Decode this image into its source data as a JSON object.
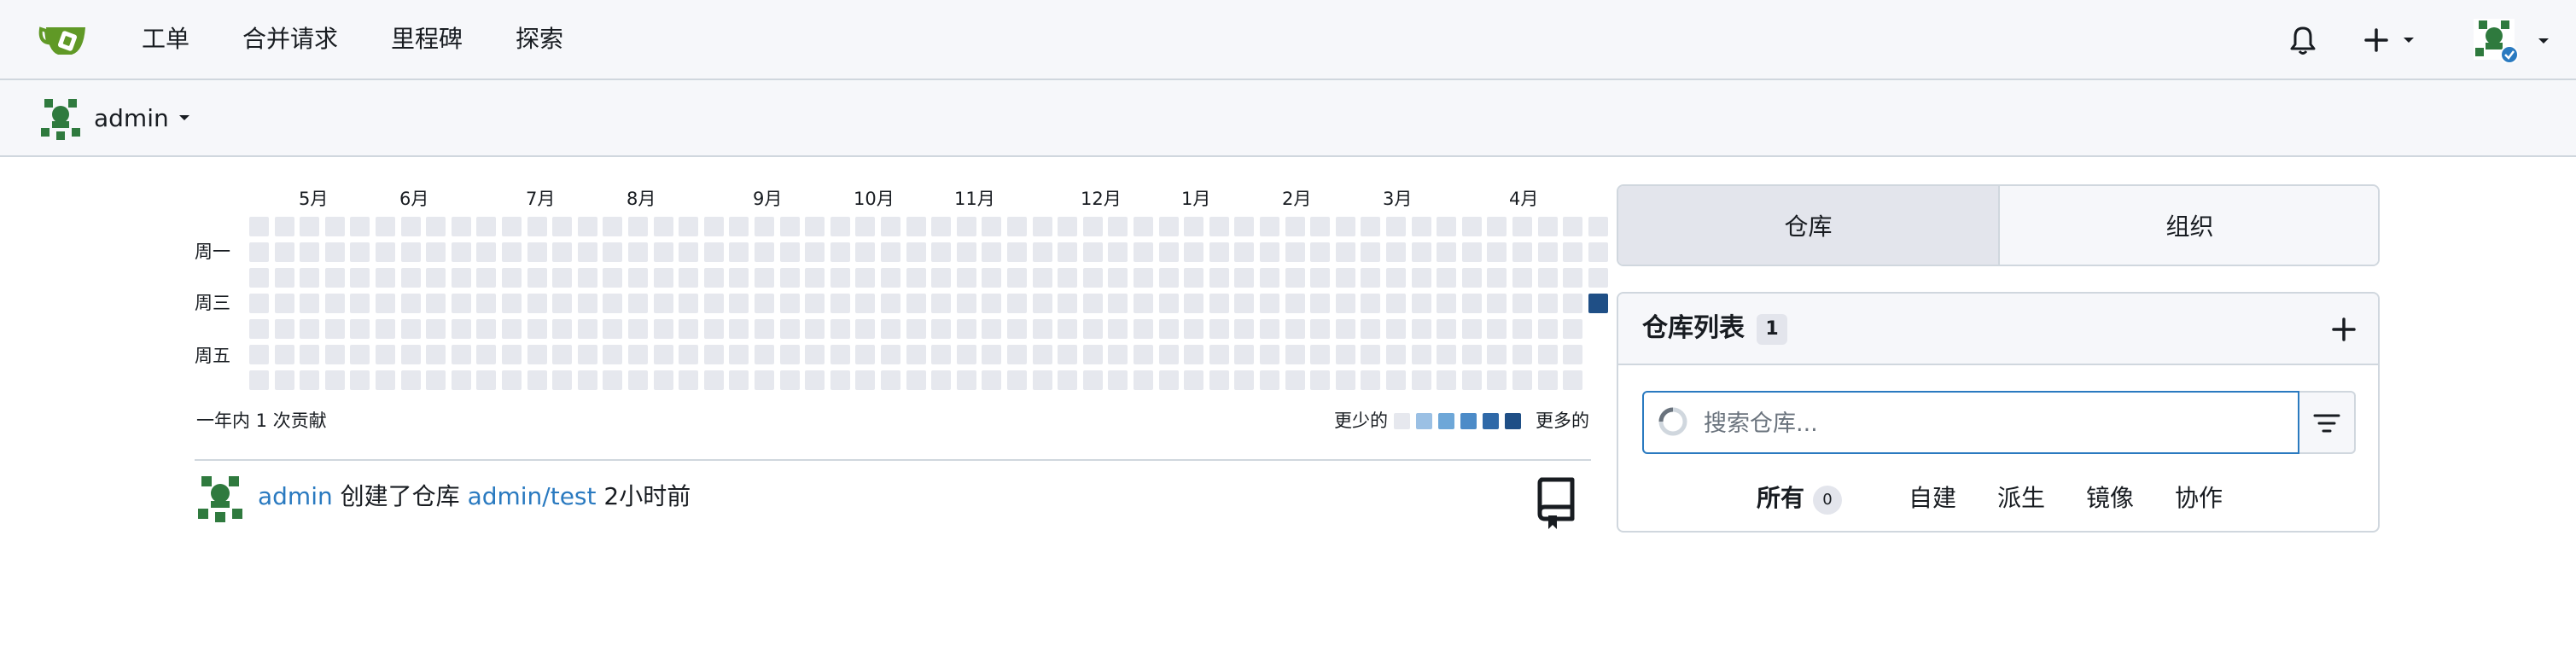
{
  "colors": {
    "accent": "#2a7ac0",
    "heat_empty": "#e6e8ee",
    "heat_levels": [
      "#9bc0e4",
      "#6ea7d8",
      "#4c8bc8",
      "#2f69a8",
      "#1f4f86"
    ],
    "brand_green": "#609926"
  },
  "navbar": {
    "logo_icon": "gitea-teacup-icon",
    "links": [
      "工单",
      "合并请求",
      "里程碑",
      "探索"
    ],
    "notifications_icon": "bell-icon",
    "create_icon": "plus-icon",
    "user_icon": "user-avatar"
  },
  "context": {
    "user": "admin"
  },
  "heatmap": {
    "months": [
      "5月",
      "6月",
      "7月",
      "8月",
      "9月",
      "10月",
      "11月",
      "12月",
      "1月",
      "2月",
      "3月",
      "4月"
    ],
    "days": [
      "周一",
      "周三",
      "周五"
    ],
    "total_label": "一年内 1 次贡献",
    "legend_less": "更少的",
    "legend_more": "更多的",
    "contributions": [
      {
        "week": 53,
        "day": 3,
        "level": 4
      }
    ]
  },
  "feed": {
    "actor": "admin",
    "action": "创建了仓库",
    "repo": "admin/test",
    "time": "2小时前",
    "icon": "repo-icon"
  },
  "panel": {
    "tabs": [
      "仓库",
      "组织"
    ],
    "repo_list_title": "仓库列表",
    "repo_count": "1",
    "search_placeholder": "搜索仓库...",
    "filter_tabs": [
      {
        "label": "所有",
        "count": "0"
      },
      {
        "label": "自建"
      },
      {
        "label": "派生"
      },
      {
        "label": "镜像"
      },
      {
        "label": "协作"
      }
    ]
  }
}
